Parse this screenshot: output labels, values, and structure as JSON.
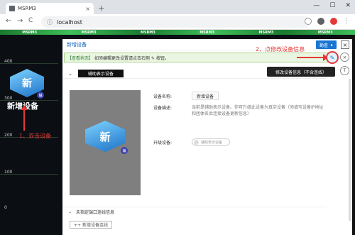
{
  "browser": {
    "tab_title": "MSRM3",
    "url": "localhost",
    "new_tab": "+",
    "close_tab": "×",
    "minimize": "—",
    "maximize": "☐",
    "close_window": "✕",
    "back": "←",
    "forward": "→",
    "reload": "C"
  },
  "app": {
    "greenbar_labels": [
      "MSRM3",
      "MSRM3",
      "MSRM3",
      "MSRM3",
      "MSRM3",
      "MSRM3"
    ],
    "y_ticks": [
      "400",
      "300",
      "200",
      "100",
      "0"
    ],
    "device_label": "新增设备",
    "device_glyph": "新",
    "device_badge": "辅"
  },
  "annotations": {
    "step1": "1、双击设备",
    "step2": "2、点修改设备信息"
  },
  "panel": {
    "title": "新增设备",
    "action_button": "勘查",
    "notice_tag": "【查看状态】",
    "notice_text": "如须编辑更改设置请点击右侧 ✎ 按钮。",
    "tooltip": "修改设备信息（不含连线）",
    "section1_label": "辅助表示设备",
    "field_name_label": "设备名称:",
    "field_name_value": "新增设备",
    "field_desc_label": "设备描述:",
    "field_desc_value": "当前是辅助表示设备。你可升级此设备为真实设备（须填写设备IP地址和团体名后连接设备更新信息）",
    "upgrade_label": "升级设备:",
    "toggle_text": "辅助表示设备",
    "section2_label": "未指定端口连线信息",
    "add_button": "++ 新增设备连线",
    "edit_icon": "✎",
    "close_icon": "×",
    "t_icon": "T"
  }
}
